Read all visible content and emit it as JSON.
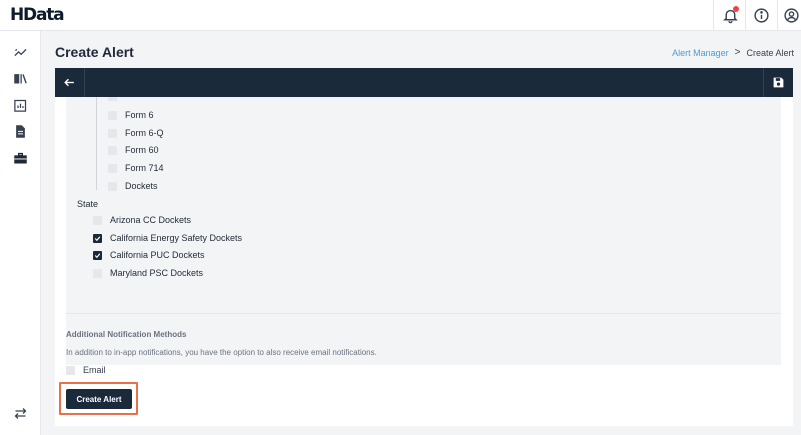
{
  "app": {
    "logo": "HData"
  },
  "colors": {
    "accent": "#1b2a3b",
    "link": "#4b9bd6",
    "highlight": "#e8714a",
    "notification": "#ef4444"
  },
  "header": {
    "icons": [
      "bell-icon",
      "info-icon",
      "user-avatar-icon"
    ]
  },
  "sidebar": {
    "icons": [
      "trend-icon",
      "book-icon",
      "analytics-icon",
      "document-icon",
      "briefcase-icon",
      "swap-icon"
    ]
  },
  "page": {
    "title": "Create Alert",
    "breadcrumb": {
      "parent": "Alert Manager",
      "separator": ">",
      "current": "Create Alert"
    }
  },
  "forms": [
    {
      "label": "Form 6",
      "checked": false
    },
    {
      "label": "Form 6-Q",
      "checked": false
    },
    {
      "label": "Form 60",
      "checked": false
    },
    {
      "label": "Form 714",
      "checked": false
    },
    {
      "label": "Dockets",
      "checked": false
    }
  ],
  "state": {
    "label": "State",
    "items": [
      {
        "label": "Arizona CC Dockets",
        "checked": false
      },
      {
        "label": "California Energy Safety Dockets",
        "checked": true
      },
      {
        "label": "California PUC Dockets",
        "checked": true
      },
      {
        "label": "Maryland PSC Dockets",
        "checked": false
      }
    ]
  },
  "notifications": {
    "title": "Additional Notification Methods",
    "description": "In addition to in-app notifications, you have the option to also receive email notifications.",
    "email_label": "Email",
    "email_checked": false
  },
  "actions": {
    "create_label": "Create Alert"
  }
}
